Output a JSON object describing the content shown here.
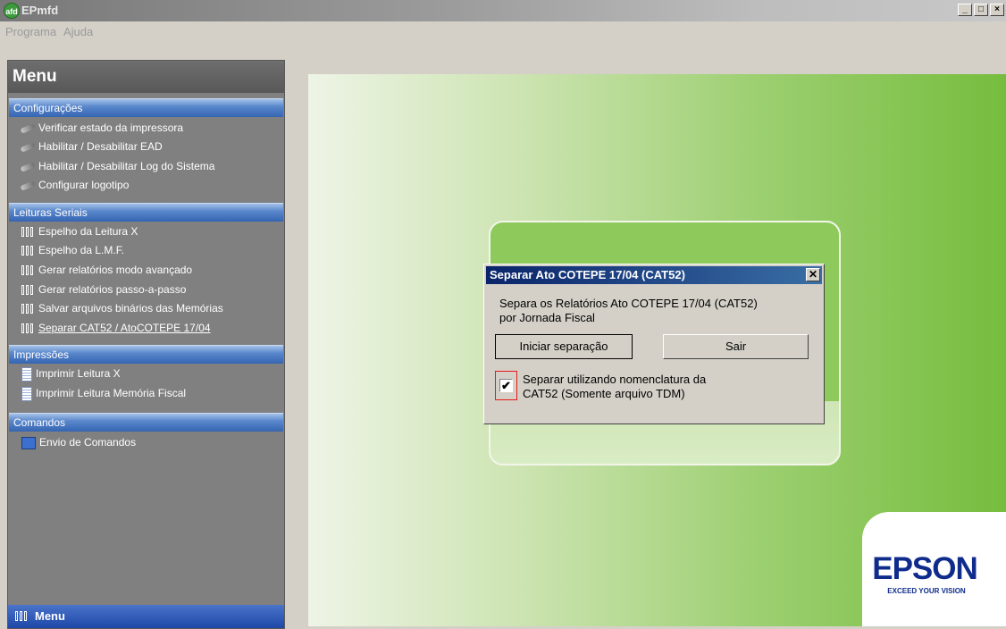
{
  "window": {
    "title": "EPmfd",
    "icon_text": "afd",
    "controls": {
      "minimize": "_",
      "maximize": "□",
      "close": "×"
    }
  },
  "menubar": {
    "items": [
      "Programa",
      "Ajuda"
    ]
  },
  "sidebar": {
    "header": "Menu",
    "sections": [
      {
        "title": "Configurações",
        "items": [
          "Verificar estado da impressora",
          "Habilitar / Desabilitar EAD",
          "Habilitar / Desabilitar Log do Sistema",
          "Configurar logotipo"
        ]
      },
      {
        "title": "Leituras Seriais",
        "items": [
          "Espelho da Leitura X",
          "Espelho da L.M.F.",
          "Gerar relatórios modo avançado",
          "Gerar relatórios passo-a-passo",
          "Salvar arquivos binários das Memórias",
          "Separar CAT52 / AtoCOTEPE 17/04"
        ]
      },
      {
        "title": "Impressões",
        "items": [
          "Imprimir Leitura X",
          "Imprimir Leitura Memória Fiscal"
        ]
      },
      {
        "title": "Comandos",
        "items": [
          "Envio de Comandos"
        ]
      }
    ],
    "bottom_label": "Menu"
  },
  "dialog": {
    "title": "Separar Ato COTEPE 17/04 (CAT52)",
    "description_line1": "Separa os Relatórios Ato COTEPE 17/04 (CAT52)",
    "description_line2": "por Jornada Fiscal",
    "start_button": "Iniciar separação",
    "exit_button": "Sair",
    "checkbox_checked": true,
    "checkbox_label_line1": "Separar utilizando nomenclatura da",
    "checkbox_label_line2": "CAT52 (Somente arquivo TDM)"
  },
  "brand": {
    "logo": "EPSON",
    "tagline": "EXCEED YOUR VISION"
  }
}
